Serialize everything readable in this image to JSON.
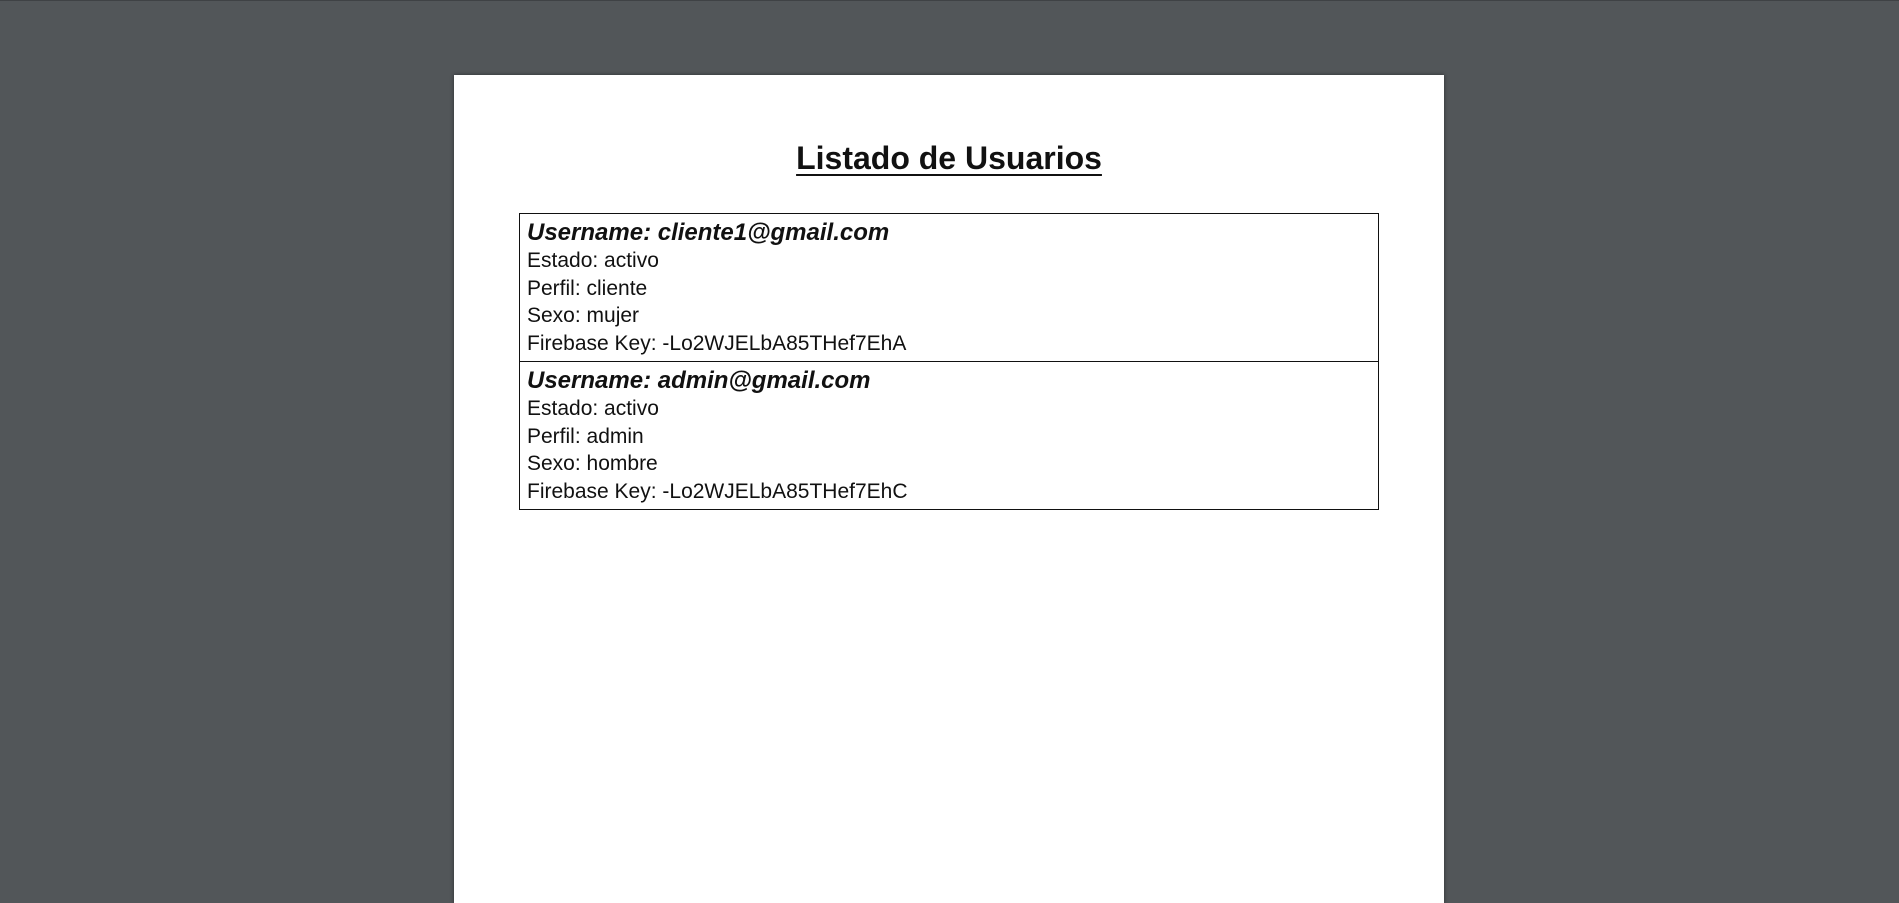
{
  "document": {
    "title": "Listado de Usuarios",
    "users": [
      {
        "username": "Username: cliente1@gmail.com",
        "estado": "Estado: activo",
        "perfil": "Perfil: cliente",
        "sexo": "Sexo: mujer",
        "firebase_key": "Firebase Key: -Lo2WJELbA85THef7EhA"
      },
      {
        "username": "Username: admin@gmail.com",
        "estado": "Estado: activo",
        "perfil": "Perfil: admin",
        "sexo": "Sexo: hombre",
        "firebase_key": "Firebase Key: -Lo2WJELbA85THef7EhC"
      }
    ]
  },
  "colors": {
    "viewer_background": "#525659",
    "page_background": "#ffffff",
    "text": "#111111"
  }
}
